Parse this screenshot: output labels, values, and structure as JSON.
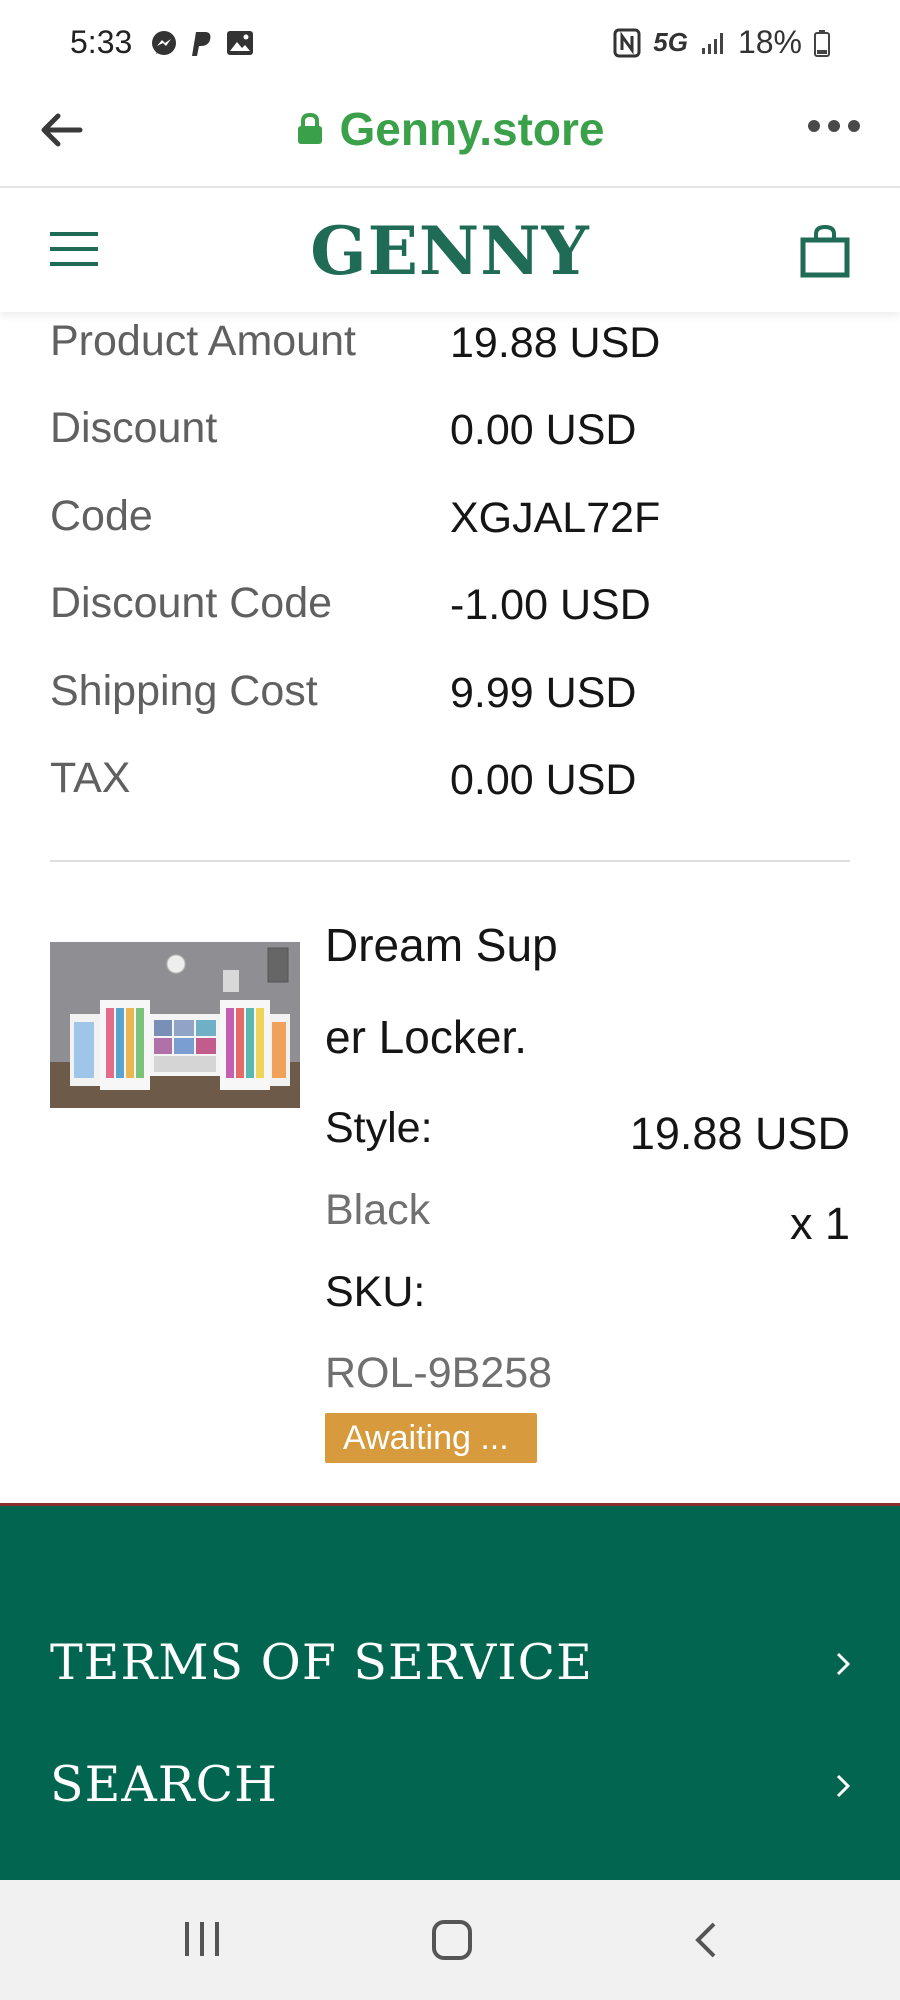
{
  "status_bar": {
    "time": "5:33",
    "network": "5G",
    "battery": "18%"
  },
  "browser": {
    "url": "Genny.store"
  },
  "header": {
    "logo": "GENNY"
  },
  "summary": [
    {
      "label": "Product Amount",
      "value": "19.88 USD"
    },
    {
      "label": "Discount",
      "value": "0.00 USD"
    },
    {
      "label": "Code",
      "value": "XGJAL72F"
    },
    {
      "label": "Discount Code",
      "value": "-1.00 USD"
    },
    {
      "label": "Shipping Cost",
      "value": "9.99 USD"
    },
    {
      "label": "TAX",
      "value": "0.00 USD"
    }
  ],
  "product": {
    "title_line1": "Dream Sup",
    "title_line2": "er Locker.",
    "style_label": "Style:",
    "style_value": "Black",
    "sku_label": "SKU:",
    "sku_value": "ROL-9B258",
    "price": "19.88 USD",
    "quantity": "x 1",
    "status": "Awaiting ..."
  },
  "footer": {
    "links": [
      "TERMS OF SERVICE",
      "SEARCH"
    ]
  },
  "colors": {
    "brand": "#1f6b55",
    "footer": "#02654f",
    "badge": "#d79a3c",
    "url": "#3aa14a"
  },
  "icons": [
    "messenger-icon",
    "paypal-icon",
    "gallery-icon",
    "nfc-icon",
    "signal-icon",
    "battery-icon",
    "back-arrow-icon",
    "lock-icon",
    "more-icon",
    "menu-icon",
    "cart-icon",
    "chevron-right-icon",
    "recents-icon",
    "home-icon",
    "back-icon"
  ]
}
